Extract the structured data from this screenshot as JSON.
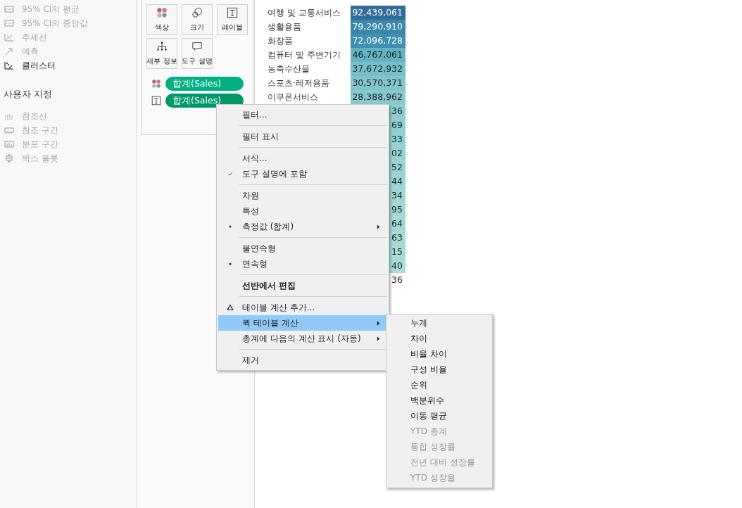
{
  "analytics": {
    "items": [
      {
        "label": "95% CI의 평균",
        "kind": "band",
        "disabled": true
      },
      {
        "label": "95% CI의 중앙값",
        "kind": "band",
        "disabled": true
      },
      {
        "label": "추세선",
        "kind": "trend",
        "disabled": true
      },
      {
        "label": "예측",
        "kind": "forecast",
        "disabled": true
      },
      {
        "label": "클러스터",
        "kind": "cluster",
        "disabled": false
      }
    ],
    "custom_heading": "사용자 지정",
    "custom_items": [
      {
        "label": "참조선",
        "kind": "refline",
        "disabled": true
      },
      {
        "label": "참조 구간",
        "kind": "band",
        "disabled": true
      },
      {
        "label": "분포 구간",
        "kind": "dist",
        "disabled": true
      },
      {
        "label": "박스 플롯",
        "kind": "box",
        "disabled": true
      }
    ]
  },
  "marks": {
    "buttons": [
      {
        "label": "색상",
        "kind": "color"
      },
      {
        "label": "크기",
        "kind": "size"
      },
      {
        "label": "레이블",
        "kind": "label"
      },
      {
        "label": "세부 정보",
        "kind": "detail"
      },
      {
        "label": "도구 설명",
        "kind": "tooltip"
      }
    ],
    "pills": [
      {
        "label": "합계(Sales)",
        "kind": "color",
        "selected": false
      },
      {
        "label": "합계(Sales)",
        "kind": "label",
        "selected": true
      }
    ]
  },
  "table": {
    "rows": [
      {
        "category": "여행 및 교통서비스",
        "value": "92,439,061",
        "color": "#2f6d98"
      },
      {
        "category": "생활용품",
        "value": "79,290,910",
        "color": "#3a87ab"
      },
      {
        "category": "화장품",
        "value": "72,096,728",
        "color": "#3f8fb1"
      },
      {
        "category": "컴퓨터 및 주변기기",
        "value": "46,767,061",
        "color": "#63b3c4"
      },
      {
        "category": "농축수산물",
        "value": "37,672,932",
        "color": "#74bfc9"
      },
      {
        "category": "스포츠·레저용품",
        "value": "30,570,371",
        "color": "#82c6cc"
      },
      {
        "category": "이쿠폰서비스",
        "value": "28,388,962",
        "color": "#86c9ce"
      },
      {
        "value": "36",
        "color": "#8dcdd0"
      },
      {
        "value": "69",
        "color": "#90cfd1"
      },
      {
        "value": "33",
        "color": "#93d0d2"
      },
      {
        "value": "02",
        "color": "#97d2d3"
      },
      {
        "value": "52",
        "color": "#9ad3d4"
      },
      {
        "value": "44",
        "color": "#9dd5d5"
      },
      {
        "value": "34",
        "color": "#a0d6d6"
      },
      {
        "value": "95",
        "color": "#a2d7d6"
      },
      {
        "value": "64",
        "color": "#a4d8d7"
      },
      {
        "value": "63",
        "color": "#a6d9d8"
      },
      {
        "value": "15",
        "color": "#a8dad8"
      },
      {
        "value": "40",
        "color": "#aadbd9"
      },
      {
        "value": "36",
        "color": "#ffffff"
      }
    ]
  },
  "context_menu": {
    "items": [
      {
        "kind": "item",
        "label": "필터...",
        "selected": false
      },
      {
        "kind": "separator"
      },
      {
        "kind": "item",
        "label": "필터 표시",
        "selected": false
      },
      {
        "kind": "separator"
      },
      {
        "kind": "item",
        "label": "서식...",
        "selected": false
      },
      {
        "kind": "check",
        "label": "도구 설명에 포함",
        "checked": true,
        "selected": false
      },
      {
        "kind": "separator"
      },
      {
        "kind": "radio",
        "label": "차원",
        "checked": false,
        "selected": false
      },
      {
        "kind": "radio",
        "label": "특성",
        "checked": false,
        "selected": false
      },
      {
        "kind": "radio",
        "label": "측정값 (합계)",
        "checked": true,
        "submenu": true,
        "selected": false
      },
      {
        "kind": "separator"
      },
      {
        "kind": "radio",
        "label": "불연속형",
        "checked": false,
        "selected": false
      },
      {
        "kind": "radio",
        "label": "연속형",
        "checked": true,
        "selected": false
      },
      {
        "kind": "separator"
      },
      {
        "kind": "item",
        "label": "선반에서 편집",
        "bold": true,
        "selected": false
      },
      {
        "kind": "separator"
      },
      {
        "kind": "calc",
        "label": "테이블 계산 추가...",
        "selected": false
      },
      {
        "kind": "item",
        "label": "퀵 테이블 계산",
        "submenu": true,
        "selected": true
      },
      {
        "kind": "item",
        "label": "총계에 다음의 계산 표시 (자동)",
        "submenu": true,
        "selected": false
      },
      {
        "kind": "separator"
      },
      {
        "kind": "item",
        "label": "제거",
        "selected": false
      }
    ]
  },
  "submenu": {
    "items": [
      {
        "label": "누계",
        "disabled": false
      },
      {
        "label": "차이",
        "disabled": false
      },
      {
        "label": "비율 차이",
        "disabled": false
      },
      {
        "label": "구성 비율",
        "disabled": false
      },
      {
        "label": "순위",
        "disabled": false
      },
      {
        "label": "백분위수",
        "disabled": false
      },
      {
        "label": "이동 평균",
        "disabled": false
      },
      {
        "label": "YTD 총계",
        "disabled": true
      },
      {
        "label": "통합 성장률",
        "disabled": true
      },
      {
        "label": "전년 대비 성장률",
        "disabled": true
      },
      {
        "label": "YTD 성장율",
        "disabled": true
      }
    ]
  }
}
